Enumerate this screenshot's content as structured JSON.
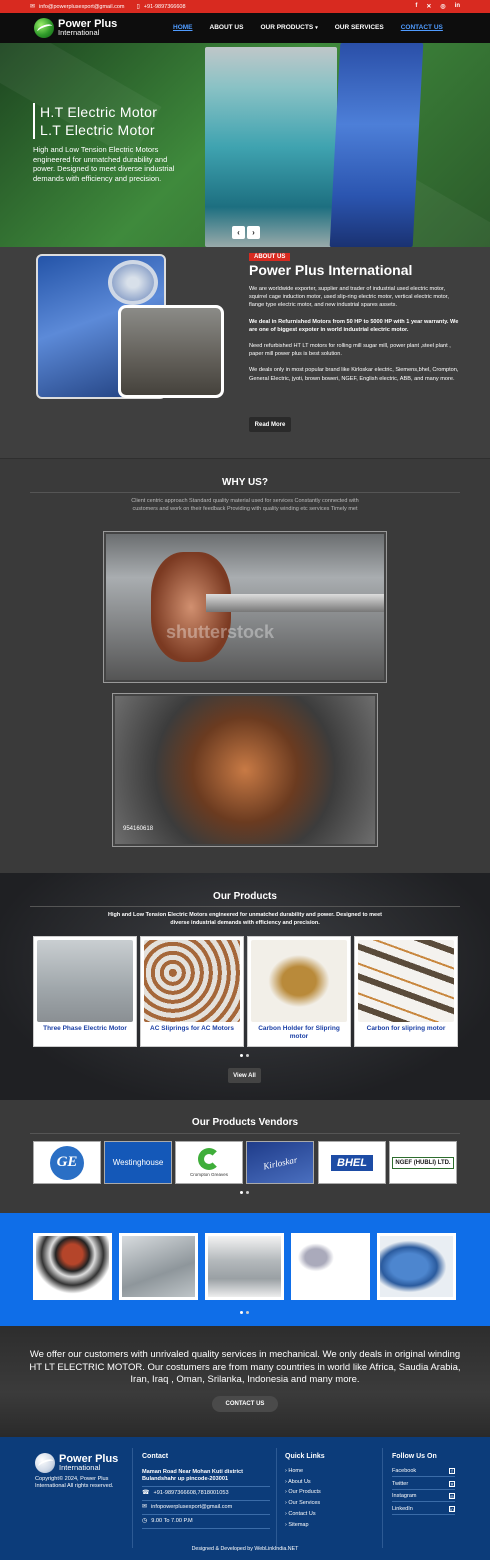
{
  "topbar": {
    "email": "info@powerplusexport@gmail.com",
    "phone": "+91-9897366608"
  },
  "brand": {
    "name_line1": "Power Plus",
    "name_line2": "International"
  },
  "nav": {
    "items": [
      "HOME",
      "ABOUT US",
      "OUR PRODUCTS",
      "OUR SERVICES",
      "CONTACT US"
    ]
  },
  "hero": {
    "title_line1": "H.T Electric Motor",
    "title_line2": "L.T Electric Motor",
    "text": "High and Low Tension Electric Motors engineered for unmatched durability and power. Designed to meet diverse industrial demands with efficiency and precision."
  },
  "about": {
    "tag": "ABOUT US",
    "title": "Power Plus International",
    "p1": "We are worldwide exporter, supplier and trader of industrial used electric motor, squirrel cage induction motor, used slip-ring electric motor, vertical electric motor, flange type electric motor, and new industrial spares assets.",
    "p2": "We deal in Refurnished Motors from 50 HP to 5000 HP with 1 year warranty. We are one of biggest expoter in world industrial electric motor.",
    "p3": "Need refurbished HT LT motors for rolling mill sugar mill, power plant ,steel plant , paper mill power plus is best solution.",
    "p4": "We deals only in most popular brand like Kirloskar electric, Siemens,bhel, Crompton, General Electric, jyoti, brown boweri, NGEF, English electric, ABB, and many more.",
    "button": "Read More"
  },
  "why": {
    "title": "WHY US?",
    "text": "Client centric approach Standard quality material used for services Constantly connected with customers and work on their feedback Providing with quality winding etc services Timely met",
    "watermark": "shutterstock",
    "image_id": "954160618"
  },
  "products": {
    "title": "Our Products",
    "text": "High and Low Tension Electric Motors engineered for unmatched durability and power. Designed to meet diverse industrial demands with efficiency and precision.",
    "items": [
      "Three Phase Electric Motor",
      "AC Sliprings for AC Motors",
      "Carbon Holder for Slipring motor",
      "Carbon for slipring motor"
    ],
    "button": "View All"
  },
  "vendors": {
    "title": "Our Products Vendors",
    "logos": [
      "GE",
      "Westinghouse",
      "Crompton Greaves",
      "Kirloskar",
      "BHEL",
      "NGEF (HUBLI) LTD."
    ]
  },
  "cta": {
    "text": "We offer our customers with unrivaled quality services in mechanical. We only deals in original winding HT LT ELECTRIC MOTOR. Our costumers are from many countries in world like Africa, Saudia Arabia, Iran, Iraq , Oman, Srilanka, Indonesia and many more.",
    "button": "CONTACT US"
  },
  "footer": {
    "copyright": "Copyright© 2024, Power Plus International All rights reserved.",
    "contact_title": "Contact",
    "address": "Maman Road Near Mohan Kuti district Bulandshahr up pincode-203001",
    "phones": "+91-9897366608,7818001053",
    "email": "infopowerplusexport@gmail.com",
    "hours": "9.00 To 7.00 P.M",
    "links_title": "Quick Links",
    "links": [
      "Home",
      "About Us",
      "Our Products",
      "Our Services",
      "Contact Us",
      "Sitemap"
    ],
    "follow_title": "Follow Us On",
    "social": [
      "Facebook",
      "Twitter",
      "Instagram",
      "LinkedIn"
    ],
    "credit": "Designed & Developed by WebLinkIndia.NET"
  }
}
